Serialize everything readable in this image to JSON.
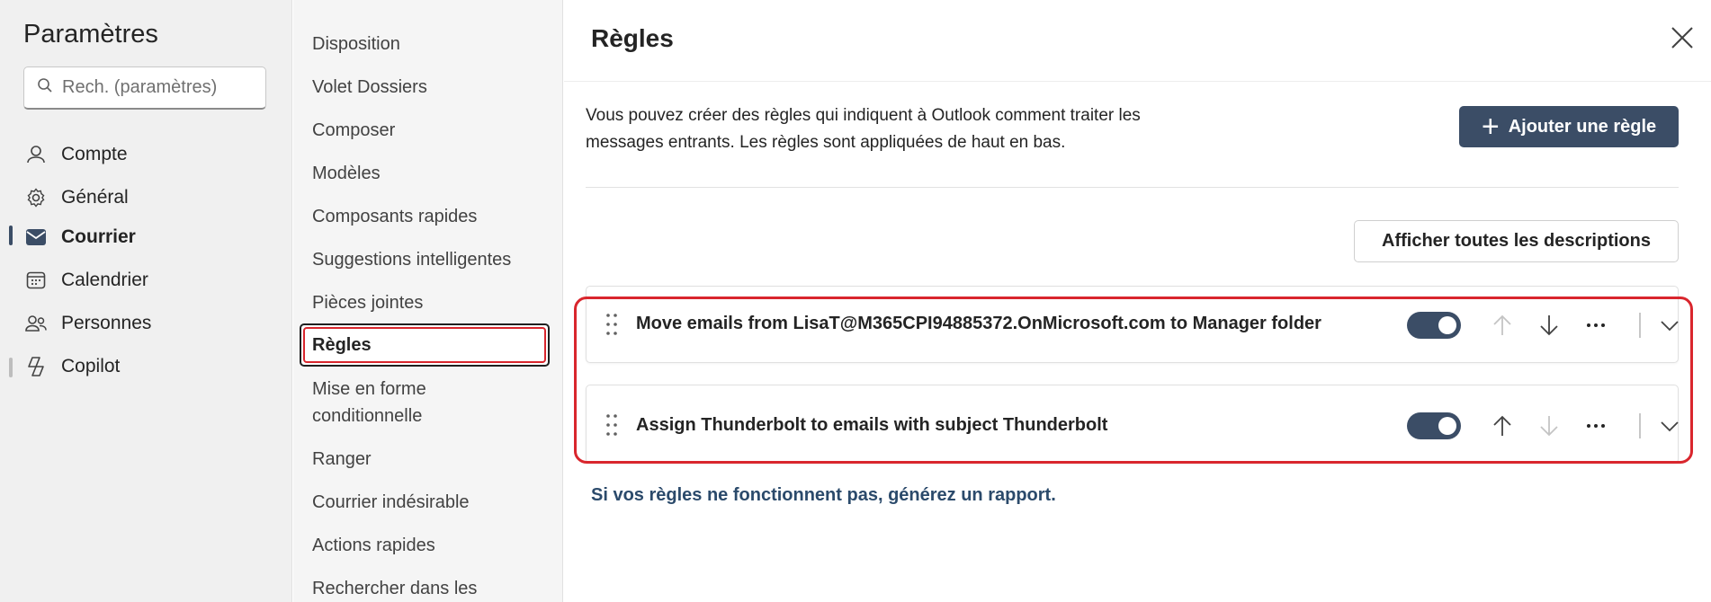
{
  "settings": {
    "title": "Paramètres",
    "search_placeholder": "Rech. (paramètres)",
    "items": [
      {
        "label": "Compte",
        "icon": "person-icon"
      },
      {
        "label": "Général",
        "icon": "gear-icon"
      },
      {
        "label": "Courrier",
        "icon": "mail-icon",
        "active": true
      },
      {
        "label": "Calendrier",
        "icon": "calendar-icon"
      },
      {
        "label": "Personnes",
        "icon": "people-icon"
      },
      {
        "label": "Copilot",
        "icon": "copilot-icon"
      }
    ]
  },
  "mail_nav": {
    "items": [
      "Disposition",
      "Volet Dossiers",
      "Composer",
      "Modèles",
      "Composants rapides",
      "Suggestions intelligentes",
      "Pièces jointes",
      "Règles",
      "Mise en forme conditionnelle",
      "Ranger",
      "Courrier indésirable",
      "Actions rapides",
      "Rechercher dans les"
    ],
    "selected": "Règles"
  },
  "main": {
    "title": "Règles",
    "intro_line1": "Vous pouvez créer des règles qui indiquent à Outlook comment traiter les",
    "intro_line2": "messages entrants. Les règles sont appliquées de haut en bas.",
    "add_rule_label": "Ajouter une règle",
    "show_descriptions_label": "Afficher toutes les descriptions",
    "rules": [
      {
        "name": "Move emails from LisaT@M365CPI94885372.OnMicrosoft.com to Manager folder",
        "enabled": true,
        "move_up_enabled": false,
        "move_down_enabled": true
      },
      {
        "name": "Assign Thunderbolt to emails with subject Thunderbolt",
        "enabled": true,
        "move_up_enabled": true,
        "move_down_enabled": false
      }
    ],
    "report_link": "Si vos règles ne fonctionnent pas, générez un rapport."
  },
  "colors": {
    "accent": "#3b4d66",
    "highlight": "#d9262d"
  }
}
